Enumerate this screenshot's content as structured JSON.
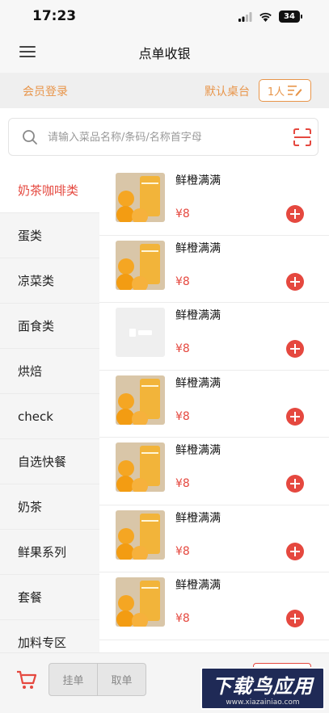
{
  "status_bar": {
    "time": "17:23",
    "battery": "34"
  },
  "nav": {
    "title": "点单收银"
  },
  "member_bar": {
    "login": "会员登录",
    "default_table": "默认桌台",
    "people": "1人"
  },
  "search": {
    "placeholder": "请输入菜品名称/条码/名称首字母"
  },
  "categories": [
    {
      "label": "奶茶咖啡类",
      "active": true
    },
    {
      "label": "蛋类"
    },
    {
      "label": "凉菜类"
    },
    {
      "label": "面食类"
    },
    {
      "label": "烘焙"
    },
    {
      "label": "check"
    },
    {
      "label": "自选快餐"
    },
    {
      "label": "奶茶"
    },
    {
      "label": "鲜果系列"
    },
    {
      "label": "套餐"
    },
    {
      "label": "加料专区"
    }
  ],
  "products": [
    {
      "name": "鲜橙满满",
      "price": "¥8",
      "image": "orange-drink"
    },
    {
      "name": "鲜橙满满",
      "price": "¥8",
      "image": "orange-drink"
    },
    {
      "name": "鲜橙满满",
      "price": "¥8",
      "image": "placeholder"
    },
    {
      "name": "鲜橙满满",
      "price": "¥8",
      "image": "orange-drink"
    },
    {
      "name": "鲜橙满满",
      "price": "¥8",
      "image": "orange-drink"
    },
    {
      "name": "鲜橙满满",
      "price": "¥8",
      "image": "orange-drink"
    },
    {
      "name": "鲜橙满满",
      "price": "¥8",
      "image": "orange-drink"
    }
  ],
  "bottom": {
    "hold_order": "挂单",
    "take_order": "取单"
  },
  "watermark": {
    "main": "下载鸟应用",
    "sub": "www.xiazainiao.com"
  },
  "colors": {
    "accent": "#e5483f",
    "orange": "#e8954a"
  }
}
